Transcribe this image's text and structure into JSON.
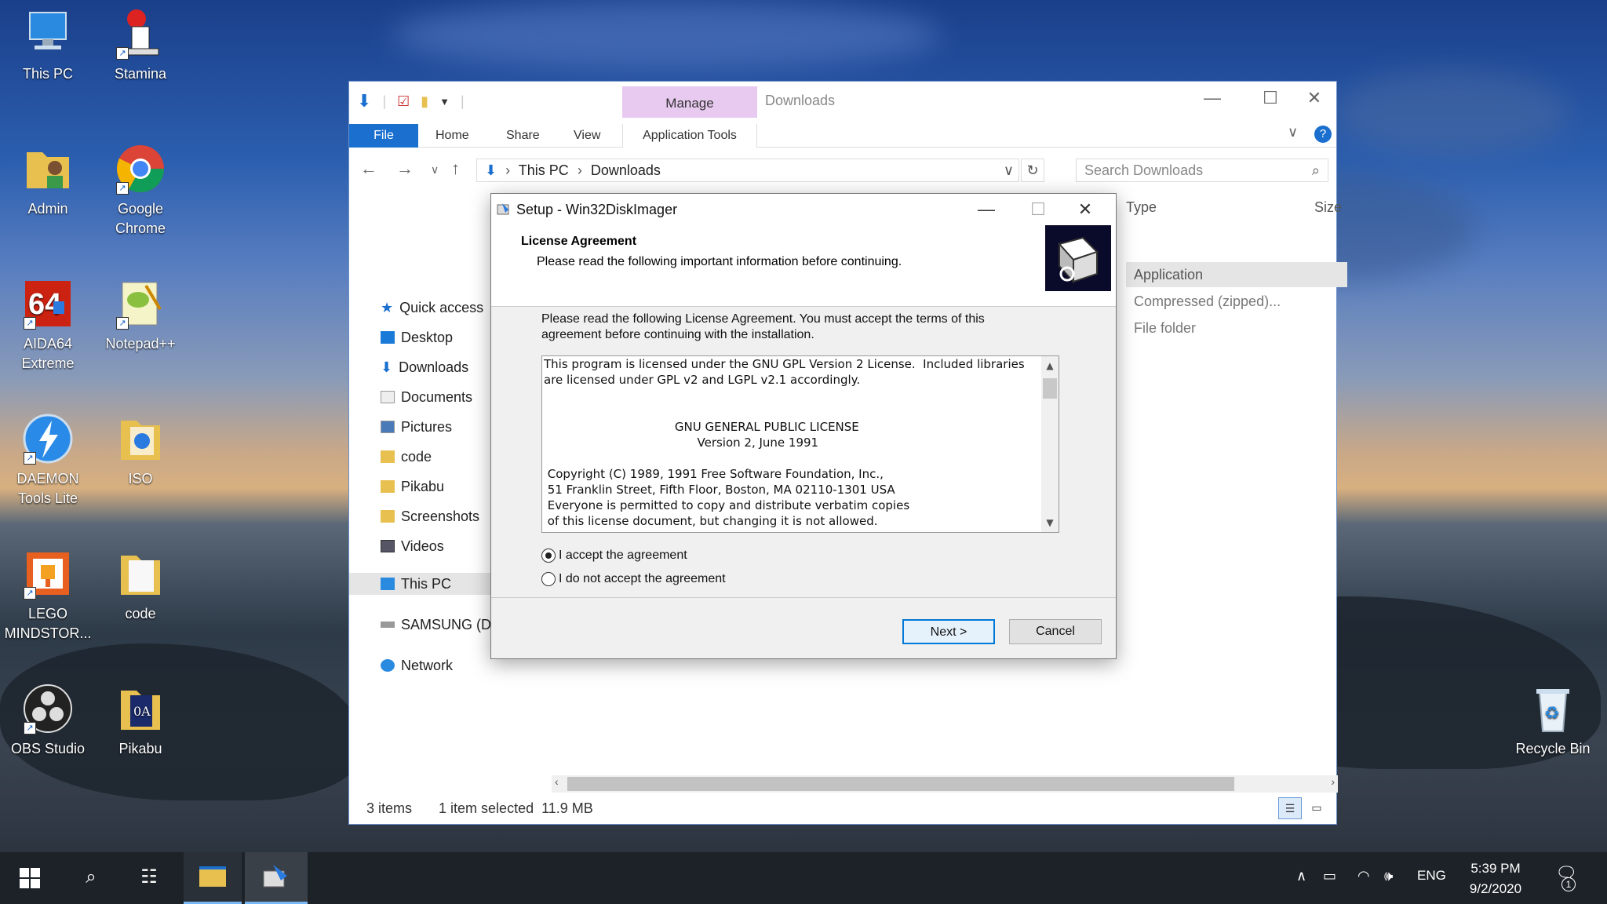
{
  "desktop": {
    "icons": [
      {
        "label": "This PC",
        "icon": "computer-icon"
      },
      {
        "label": "Stamina",
        "icon": "stamina-icon"
      },
      {
        "label": "Admin",
        "icon": "user-folder-icon"
      },
      {
        "label": "Google Chrome",
        "icon": "chrome-icon"
      },
      {
        "label": "AIDA64 Extreme",
        "icon": "aida64-icon"
      },
      {
        "label": "Notepad++",
        "icon": "notepadpp-icon"
      },
      {
        "label": "DAEMON Tools Lite",
        "icon": "daemon-tools-icon"
      },
      {
        "label": "ISO",
        "icon": "folder-icon"
      },
      {
        "label": "LEGO MINDSTOR...",
        "icon": "lego-icon"
      },
      {
        "label": "code",
        "icon": "folder-icon"
      },
      {
        "label": "OBS Studio",
        "icon": "obs-icon"
      },
      {
        "label": "Pikabu",
        "icon": "folder-icon"
      },
      {
        "label": "Recycle Bin",
        "icon": "recycle-bin-icon"
      }
    ]
  },
  "explorer": {
    "title": "Downloads",
    "contextual_tab": "Manage",
    "tabs": {
      "file": "File",
      "home": "Home",
      "share": "Share",
      "view": "View",
      "app_tools": "Application Tools"
    },
    "breadcrumb": {
      "root": "This PC",
      "current": "Downloads"
    },
    "search_placeholder": "Search Downloads",
    "nav": {
      "quick_access": "Quick access",
      "desktop": "Desktop",
      "downloads": "Downloads",
      "documents": "Documents",
      "pictures": "Pictures",
      "code": "code",
      "pikabu": "Pikabu",
      "screenshots": "Screenshots",
      "videos": "Videos",
      "this_pc": "This PC",
      "samsung": "SAMSUNG (D",
      "network": "Network"
    },
    "columns": {
      "type": "Type",
      "size": "Size"
    },
    "files": [
      {
        "type": "Application"
      },
      {
        "type": "Compressed (zipped)..."
      },
      {
        "type": "File folder"
      }
    ],
    "status": {
      "items": "3 items",
      "selected": "1 item selected",
      "size": "11.9 MB"
    }
  },
  "setup": {
    "title": "Setup - Win32DiskImager",
    "heading": "License Agreement",
    "subheading": "Please read the following important information before continuing.",
    "intro": "Please read the following License Agreement. You must accept the terms of this agreement before continuing with the installation.",
    "license_lines": [
      "This program is licensed under the GNU GPL Version 2 License.  Included libraries",
      "are licensed under GPL v2 and LGPL v2.1 accordingly.",
      "",
      "",
      "                                   GNU GENERAL PUBLIC LICENSE",
      "                                         Version 2, June 1991",
      "",
      " Copyright (C) 1989, 1991 Free Software Foundation, Inc.,",
      " 51 Franklin Street, Fifth Floor, Boston, MA 02110-1301 USA",
      " Everyone is permitted to copy and distribute verbatim copies",
      " of this license document, but changing it is not allowed."
    ],
    "accept": "I accept the agreement",
    "decline": "I do not accept the agreement",
    "next": "Next >",
    "cancel": "Cancel"
  },
  "taskbar": {
    "lang": "ENG",
    "time": "5:39 PM",
    "date": "9/2/2020",
    "notifications": "1"
  }
}
